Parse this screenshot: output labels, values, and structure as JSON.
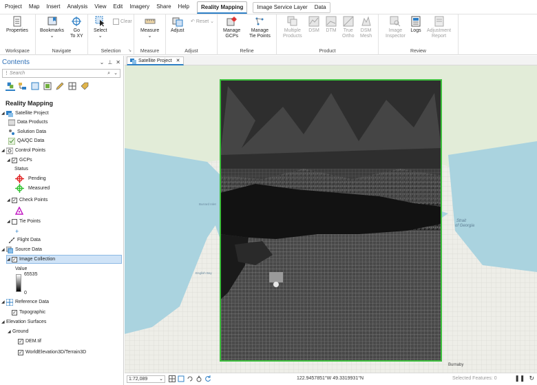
{
  "menu": {
    "items": [
      "Project",
      "Map",
      "Insert",
      "Analysis",
      "View",
      "Edit",
      "Imagery",
      "Share",
      "Help"
    ],
    "active_tab": "Reality Mapping",
    "context_tabs": [
      "Image Service Layer",
      "Data"
    ]
  },
  "ribbon": {
    "workspace": {
      "label": "Workspace",
      "properties": "Properties"
    },
    "navigate": {
      "label": "Navigate",
      "bookmarks": "Bookmarks",
      "goto": "Go\nTo XY"
    },
    "selection": {
      "label": "Selection",
      "select": "Select",
      "clear": "Clear"
    },
    "measure": {
      "label": "Measure",
      "measure": "Measure"
    },
    "adjust": {
      "label": "Adjust",
      "adjust": "Adjust",
      "reset": "Reset"
    },
    "refine": {
      "label": "Refine",
      "manage_gcps": "Manage\nGCPs",
      "manage_tie": "Manage\nTie Points"
    },
    "product": {
      "label": "Product",
      "multiple": "Multiple\nProducts",
      "dsm": "DSM",
      "dtm": "DTM",
      "true_ortho": "True\nOrtho",
      "dsm_mesh": "DSM\nMesh"
    },
    "review": {
      "label": "Review",
      "inspector": "Image\nInspector",
      "logs": "Logs",
      "adjustment_report": "Adjustment\nReport"
    }
  },
  "contents": {
    "title": "Contents",
    "search_placeholder": "Search",
    "heading": "Reality Mapping",
    "tree": {
      "satellite_project": "Satellite Project",
      "data_products": "Data Products",
      "solution_data": "Solution Data",
      "qaqc_data": "QA/QC Data",
      "control_points": "Control Points",
      "gcps": "GCPs",
      "status": "Status",
      "pending": "Pending",
      "measured": "Measured",
      "check_points": "Check Points",
      "tie_points": "Tie Points",
      "flight_data": "Flight Data",
      "source_data": "Source Data",
      "image_collection": "Image Collection",
      "value": "Value",
      "value_max": "65535",
      "value_min": "0",
      "reference_data": "Reference Data",
      "topographic": "Topographic",
      "elevation_surfaces": "Elevation Surfaces",
      "ground": "Ground",
      "dem": "DEM.tif",
      "world_elevation": "WorldElevation3D/Terrain3D"
    }
  },
  "map": {
    "tab_label": "Satellite Project",
    "place_labels": {
      "burrard_inlet": "Burrard Inlet",
      "strait": "Strait\nof Georgia",
      "english_bay": "English Bay",
      "burnaby": "Burnaby"
    }
  },
  "status": {
    "scale": "1:72,089",
    "coordinates": "122.9457851°W 49.3319931°N",
    "selected_features": "Selected Features: 0"
  },
  "colors": {
    "accent": "#2d7fc6",
    "water": "#aad3df",
    "land": "#eeeee6",
    "image_border": "#3cc03c"
  }
}
